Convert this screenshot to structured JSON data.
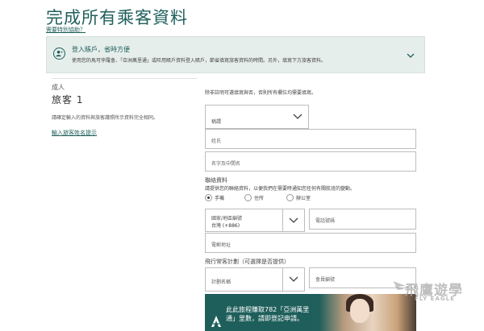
{
  "page": {
    "title": "完成所有乘客資料",
    "help_link": "需要特別協助？"
  },
  "login": {
    "title": "登入賬戶，省時方便",
    "description": "使用您的馬可孛羅會、「亞洲萬里通」或旺用賬戶資料登入賬戶，節省填寫旅客資料的時間。另外，填寫下方旅客資料。",
    "icons": {
      "user": "user-circle-icon",
      "expand": "chevron-down-icon"
    }
  },
  "passenger": {
    "type": "成人",
    "name": "旅客 1",
    "note": "請確定輸入的資料與旅客護照所示資料完全相同。",
    "tip_link": "輸入旅客姓名提示"
  },
  "form": {
    "required_note": "除非註明可選填寫與否，否則所有欄位均需要填寫。",
    "title_select": {
      "placeholder": "稱謂"
    },
    "surname": {
      "placeholder": "姓氏"
    },
    "given_name": {
      "placeholder": "名字及中間名"
    },
    "contact": {
      "label": "聯絡資料",
      "description": "請提供您的聯絡資料，以便我們在需要時通知您任何有關航班的變動。",
      "options": [
        {
          "label": "手機",
          "selected": true
        },
        {
          "label": "住所",
          "selected": false
        },
        {
          "label": "辦公室",
          "selected": false
        }
      ],
      "country_select": {
        "label": "國家/地區編號",
        "value": "台灣 (+886)"
      },
      "phone": {
        "placeholder": "電話號碼"
      },
      "email": {
        "placeholder": "電郵地址"
      }
    },
    "frequent_flyer": {
      "label": "飛行常客計劃（可選擇是否提供）",
      "program_select": {
        "placeholder": "計劃名稱"
      },
      "member_number": {
        "placeholder": "會員編號"
      }
    }
  },
  "promo": {
    "text": "此此旅程賺取782「亞洲萬里通」里數，請即登記申請。"
  },
  "watermark": {
    "text": "飛鷹遊學",
    "sub": "FLY EAGLE"
  },
  "colors": {
    "brand": "#1f5f5b",
    "panel": "#e6eeec",
    "border": "#bdbdbd"
  }
}
